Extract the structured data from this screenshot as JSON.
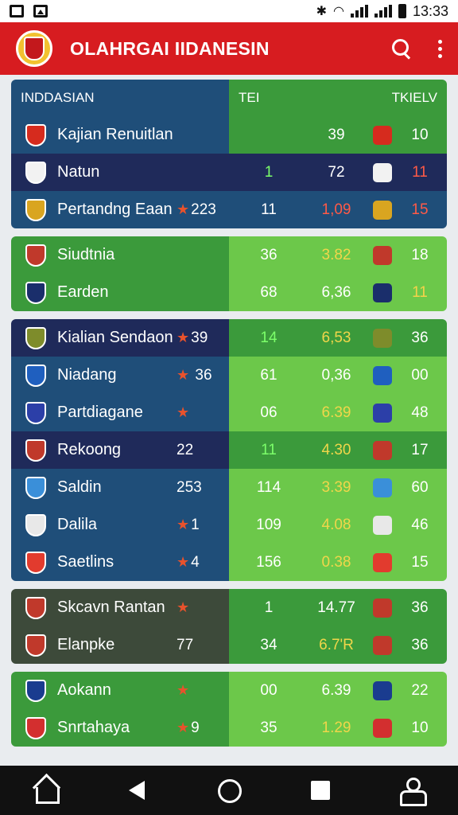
{
  "status_bar": {
    "time": "13:33"
  },
  "app_bar": {
    "title": "OLAHRGAI IIDANESIN",
    "search_icon": "search-icon",
    "menu_icon": "kebab-menu-icon"
  },
  "table_header": {
    "left": "INDDASIAN",
    "col1": "TEI",
    "col2": "TKIELV"
  },
  "colors": {
    "brand_red": "#d71c20",
    "navy": "#1f2a5a",
    "blue": "#1f4e79",
    "green": "#3b9a3b",
    "light_green": "#6cc84a",
    "olive": "#3d4a3a"
  },
  "groups": [
    {
      "rows": [
        {
          "name": "Kajian Renuitlan",
          "extra": "",
          "c1": "",
          "c2": "39",
          "c4": "10",
          "icon": "team-crest-icon",
          "left_bg": "#1f4e79",
          "right_bg": "#3b9a3b",
          "badge": "#d62b1e"
        },
        {
          "name": "Natun",
          "extra": "",
          "c1": "1",
          "c2": "72",
          "c4": "11",
          "icon": "box-icon",
          "left_bg": "#1f2a5a",
          "right_bg": "#1f2a5a",
          "badge": "#f2f2f2",
          "c4_red": true,
          "c1_green": true
        },
        {
          "name": "Pertandng Eaan",
          "extra": "★223",
          "c1": "11",
          "c2": "1,09",
          "c4": "15",
          "icon": "shield-icon",
          "left_bg": "#1f4e79",
          "right_bg": "#1f4e79",
          "badge": "#d9a520",
          "c2_red": true,
          "c4_red": true
        }
      ]
    },
    {
      "rows": [
        {
          "name": "Siudtnia",
          "extra": "",
          "c1": "36",
          "c2": "3.82",
          "c4": "18",
          "icon": "team-crest-icon",
          "left_bg": "#3b9a3b",
          "right_bg": "#6cc84a",
          "badge": "#c0392b",
          "c2_yellow": true
        },
        {
          "name": "Earden",
          "extra": "",
          "c1": "68",
          "c2": "6,36",
          "c4": "11",
          "icon": "team-crest-icon",
          "left_bg": "#3b9a3b",
          "right_bg": "#6cc84a",
          "badge": "#1a2e6b",
          "c4_yellow": true
        }
      ]
    },
    {
      "rows": [
        {
          "name": "Kialian Sendaon",
          "extra": "★39",
          "c1": "14",
          "c2": "6,53",
          "c4": "36",
          "icon": "team-crest-icon",
          "left_bg": "#1f2a5a",
          "right_bg": "#3b9a3b",
          "badge": "#7e8c2b",
          "c1_green": true,
          "c2_yellow": true
        },
        {
          "name": "Niadang",
          "extra": "★   36",
          "c1": "61",
          "c2": "0,36",
          "c4": "00",
          "icon": "team-crest-icon",
          "left_bg": "#1f4e79",
          "right_bg": "#6cc84a",
          "badge": "#1f5fbf"
        },
        {
          "name": "Partdiagane",
          "extra": "★",
          "c1": "06",
          "c2": "6.39",
          "c4": "48",
          "icon": "team-crest-icon",
          "left_bg": "#1f4e79",
          "right_bg": "#6cc84a",
          "badge": "#2c3fa8",
          "c2_yellow": true
        },
        {
          "name": "Rekoong",
          "extra": "22",
          "c1": "11",
          "c2": "4.30",
          "c4": "17",
          "icon": "lock-icon",
          "left_bg": "#1f2a5a",
          "right_bg": "#3b9a3b",
          "badge": "#c0392b",
          "c1_green": true,
          "c2_yellow": true
        },
        {
          "name": "Saldin",
          "extra": "253",
          "c1": "114",
          "c2": "3.39",
          "c4": "60",
          "icon": "team-crest-icon",
          "left_bg": "#1f4e79",
          "right_bg": "#6cc84a",
          "badge": "#3a8fd9",
          "c2_yellow": true
        },
        {
          "name": "Dalila",
          "extra": "★1",
          "c1": "109",
          "c2": "4.08",
          "c4": "46",
          "icon": "team-crest-icon",
          "left_bg": "#1f4e79",
          "right_bg": "#6cc84a",
          "badge": "#e8e8e8",
          "c2_yellow": true
        },
        {
          "name": "Saetlins",
          "extra": "★4",
          "c1": "156",
          "c2": "0.38",
          "c4": "15",
          "icon": "team-crest-icon",
          "left_bg": "#1f4e79",
          "right_bg": "#6cc84a",
          "badge": "#e23b2e",
          "c2_yellow": true
        }
      ]
    },
    {
      "rows": [
        {
          "name": "Skcavn Rantan",
          "extra": "★",
          "c1": "1",
          "c2": "14.77",
          "c4": "36",
          "icon": "team-crest-icon",
          "left_bg": "#3d4a3a",
          "right_bg": "#3b9a3b",
          "badge": "#c0392b"
        },
        {
          "name": "Elanpke",
          "extra": "77",
          "c1": "34",
          "c2": "6.7'R",
          "c4": "36",
          "icon": "team-crest-icon",
          "left_bg": "#3d4a3a",
          "right_bg": "#3b9a3b",
          "badge": "#c0392b",
          "c2_yellow": true
        }
      ]
    },
    {
      "rows": [
        {
          "name": "Aokann",
          "extra": "★",
          "c1": "00",
          "c2": "6.39",
          "c4": "22",
          "icon": "team-crest-icon",
          "left_bg": "#3b9a3b",
          "right_bg": "#6cc84a",
          "badge": "#1a3c8f"
        },
        {
          "name": "Snrtahaya",
          "extra": "★9",
          "c1": "35",
          "c2": "1.29",
          "c4": "10",
          "icon": "team-crest-icon",
          "left_bg": "#3b9a3b",
          "right_bg": "#6cc84a",
          "badge": "#d32f2f",
          "c2_yellow": true
        }
      ]
    }
  ],
  "nav_bar": {
    "icons": [
      "home-icon",
      "back-icon",
      "home-circle-icon",
      "recents-icon",
      "profile-icon"
    ]
  }
}
